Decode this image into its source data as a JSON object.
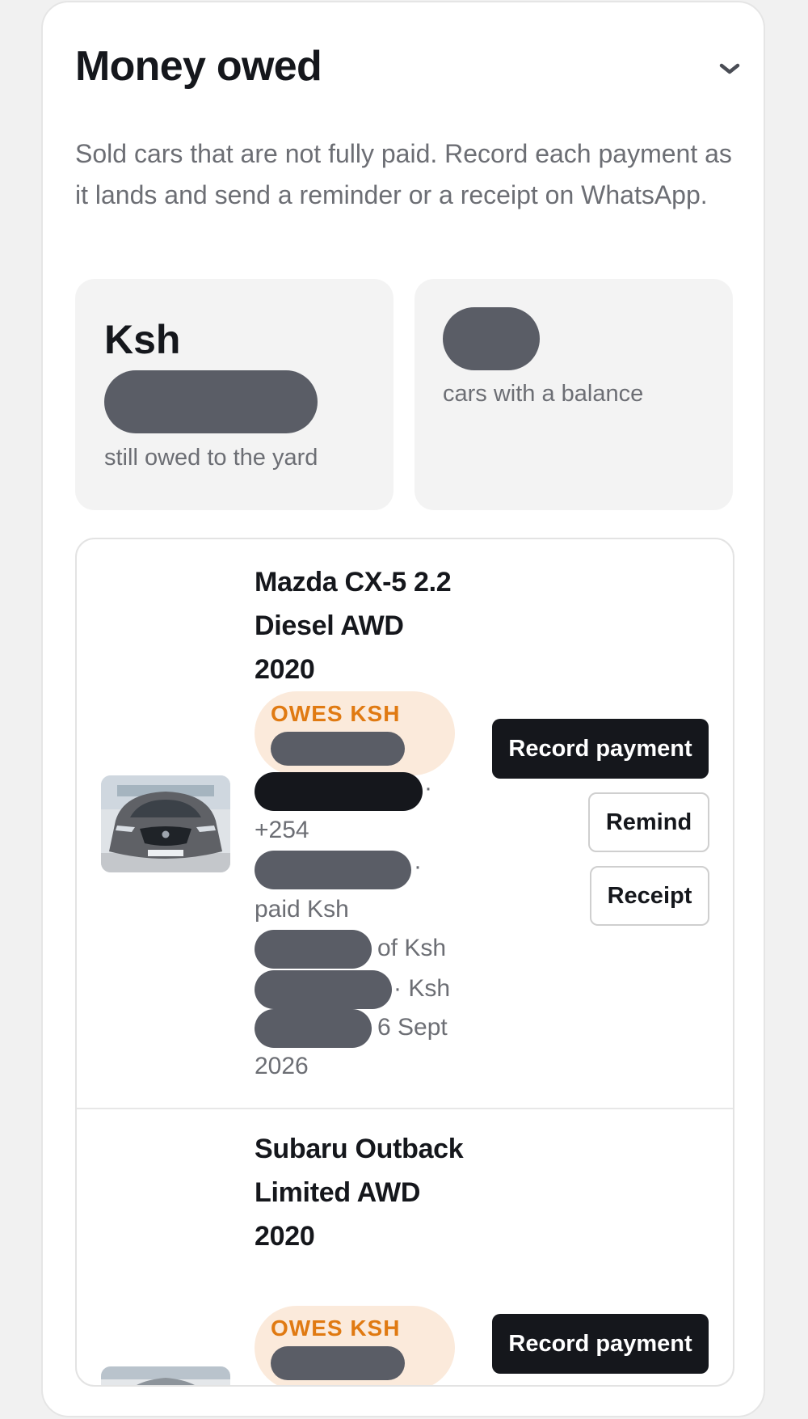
{
  "section": {
    "title": "Money owed",
    "description": "Sold cars that are not fully paid. Record each payment as it lands and send a reminder or a receipt on WhatsApp."
  },
  "summary": {
    "currency": "Ksh",
    "owed_label": "still owed to the yard",
    "balance_label": "cars with a balance"
  },
  "cars": [
    {
      "name": "Mazda CX-5 2.2 Diesel AWD 2020",
      "owes_label": "OWES KSH",
      "phone_prefix": "+254",
      "paid_prefix": "paid Ksh",
      "of_text": "of Ksh",
      "due_text": "· Ksh",
      "date_text": "6 Sept",
      "year_text": "2026",
      "buttons": {
        "record": "Record payment",
        "remind": "Remind",
        "receipt": "Receipt"
      }
    },
    {
      "name": "Subaru Outback Limited AWD 2020",
      "owes_label": "OWES KSH",
      "buttons": {
        "record": "Record payment"
      }
    }
  ]
}
